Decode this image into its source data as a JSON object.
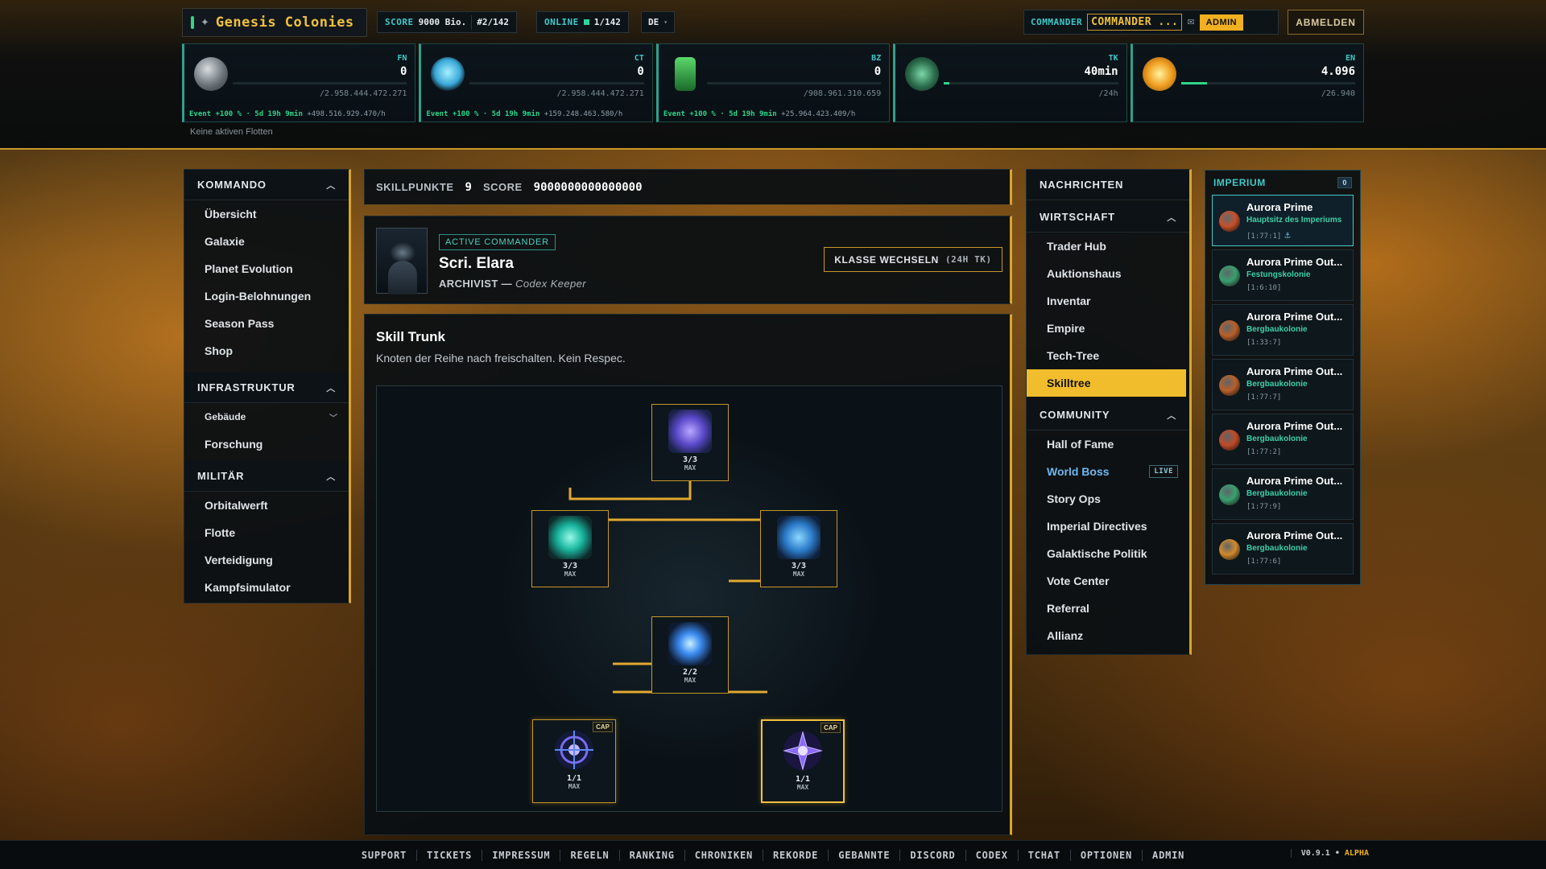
{
  "app": {
    "title": "Genesis Colonies",
    "score_label": "SCORE",
    "score_value": "9000 Bio.",
    "rank": "#2/142",
    "online_label": "ONLINE",
    "online_value": "1/142",
    "language": "DE",
    "commander_label": "COMMANDER",
    "commander_name": "COMMANDER ...",
    "admin_badge": "ADMIN",
    "logout_label": "ABMELDEN"
  },
  "resources": [
    {
      "code": "FN",
      "value": "0",
      "capacity": "/2.958.444.472.271",
      "fill": 0.0,
      "event": "Event +100 % · 5d 19h 9min",
      "rate": "+498.516.929.470/h",
      "icon": "metal-ore-icon"
    },
    {
      "code": "CT",
      "value": "0",
      "capacity": "/2.958.444.472.271",
      "fill": 0.0,
      "event": "Event +100 % · 5d 19h 9min",
      "rate": "+159.248.463.580/h",
      "icon": "crystal-icon"
    },
    {
      "code": "BZ",
      "value": "0",
      "capacity": "/908.961.310.659",
      "fill": 0.0,
      "event": "Event +100 % · 5d 19h 9min",
      "rate": "+25.964.423.409/h",
      "icon": "fuel-canister-icon"
    },
    {
      "code": "TK",
      "value": "40min",
      "capacity": "/24h",
      "fill": 0.03,
      "event": "",
      "rate": "",
      "icon": "alien-emblem-icon"
    },
    {
      "code": "EN",
      "value": "4.096",
      "capacity": "/26.940",
      "fill": 0.15,
      "event": "",
      "rate": "",
      "icon": "energy-orb-icon"
    }
  ],
  "fleets_status": "Keine aktiven Flotten",
  "left_nav": [
    {
      "title": "KOMMANDO",
      "items": [
        "Übersicht",
        "Galaxie",
        "Planet Evolution",
        "Login-Belohnungen",
        "Season Pass",
        "Shop"
      ]
    },
    {
      "title": "INFRASTRUKTUR",
      "items": [
        "Gebäude",
        "Forschung"
      ]
    },
    {
      "title": "MILITÄR",
      "items": [
        "Orbitalwerft",
        "Flotte",
        "Verteidigung",
        "Kampfsimulator"
      ]
    }
  ],
  "skillbar": {
    "points_label": "SKILLPUNKTE",
    "points": "9",
    "score_label": "SCORE",
    "score": "9000000000000000"
  },
  "commander": {
    "badge": "ACTIVE COMMANDER",
    "name": "Scri. Elara",
    "class": "ARCHIVIST",
    "subclass": "Codex Keeper",
    "switch_label": "KLASSE WECHSELN",
    "switch_cost": "(24H TK)"
  },
  "trunk": {
    "title": "Skill Trunk",
    "description": "Knoten der Reihe nach freischalten. Kein Respec.",
    "nodes": [
      {
        "level": "3/3",
        "max": "MAX",
        "cap": "",
        "icon": "data-cube-icon"
      },
      {
        "level": "3/3",
        "max": "MAX",
        "cap": "",
        "icon": "crystal-vial-icon"
      },
      {
        "level": "3/3",
        "max": "MAX",
        "cap": "",
        "icon": "server-stack-icon"
      },
      {
        "level": "2/2",
        "max": "MAX",
        "cap": "",
        "icon": "atom-icon"
      },
      {
        "level": "1/1",
        "max": "MAX",
        "cap": "CAP",
        "icon": "reticle-gear-icon"
      },
      {
        "level": "1/1",
        "max": "MAX",
        "cap": "CAP",
        "icon": "compass-star-icon"
      }
    ]
  },
  "right_nav": {
    "messages": "NACHRICHTEN",
    "economy": {
      "title": "WIRTSCHAFT",
      "items": [
        "Trader Hub",
        "Auktionshaus",
        "Inventar",
        "Empire",
        "Tech-Tree",
        "Skilltree"
      ],
      "active": "Skilltree"
    },
    "community": {
      "title": "COMMUNITY",
      "items": [
        "Hall of Fame",
        "World Boss",
        "Story Ops",
        "Imperial Directives",
        "Galaktische Politik",
        "Vote Center",
        "Referral",
        "Allianz"
      ],
      "live_badge": "LIVE"
    }
  },
  "imperium": {
    "title": "IMPERIUM",
    "count": "0",
    "planets": [
      {
        "name": "Aurora Prime",
        "type": "Hauptsitz des Imperiums",
        "coords": "[1:77:1]",
        "color": "#c8502a"
      },
      {
        "name": "Aurora Prime Out...",
        "type": "Festungskolonie",
        "coords": "[1:6:10]",
        "color": "#3aa070"
      },
      {
        "name": "Aurora Prime Out...",
        "type": "Bergbaukolonie",
        "coords": "[1:33:7]",
        "color": "#b8602a"
      },
      {
        "name": "Aurora Prime Out...",
        "type": "Bergbaukolonie",
        "coords": "[1:77:7]",
        "color": "#b8602a"
      },
      {
        "name": "Aurora Prime Out...",
        "type": "Bergbaukolonie",
        "coords": "[1:77:2]",
        "color": "#c04a28"
      },
      {
        "name": "Aurora Prime Out...",
        "type": "Bergbaukolonie",
        "coords": "[1:77:9]",
        "color": "#3aa070"
      },
      {
        "name": "Aurora Prime Out...",
        "type": "Bergbaukolonie",
        "coords": "[1:77:6]",
        "color": "#d08a2a"
      }
    ]
  },
  "footer": {
    "links": [
      "SUPPORT",
      "TICKETS",
      "IMPRESSUM",
      "REGELN",
      "RANKING",
      "CHRONIKEN",
      "REKORDE",
      "GEBANNTE",
      "DISCORD",
      "CODEX",
      "TCHAT",
      "OPTIONEN",
      "ADMIN"
    ],
    "version": "V0.9.1",
    "stage": "ALPHA"
  }
}
